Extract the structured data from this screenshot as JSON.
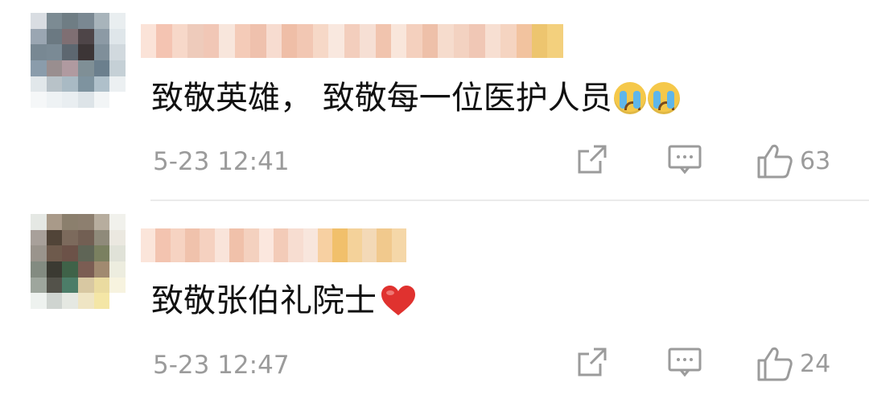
{
  "comments": [
    {
      "text": "致敬英雄， 致敬每一位医护人员",
      "emojis": [
        "crying-emoji",
        "crying-emoji"
      ],
      "time": "5-23 12:41",
      "like_count": "63",
      "avatar_colors": [
        "#d9dde2",
        "#7c8b93",
        "#6f7d84",
        "#7a8892",
        "#a8b4bb",
        "#e9eef0",
        "#9aa6b2",
        "#6b7982",
        "#7f6f73",
        "#4e4548",
        "#8c9aa5",
        "#dfe6ea",
        "#788893",
        "#7a8a95",
        "#5d6770",
        "#3c3536",
        "#7f8f9a",
        "#d1d9de",
        "#8a9cab",
        "#998e8f",
        "#b09aa0",
        "#7f8f96",
        "#6b7f8d",
        "#c5d0d6",
        "#e1e7ea",
        "#b8c2c8",
        "#a9bac4",
        "#7e939f",
        "#afc0ca",
        "#ecf0f2",
        "#f5f7f8",
        "#eef2f4",
        "#e9eef1",
        "#dde4e8",
        "#f2f5f6",
        "#ffffff"
      ],
      "username_colors": [
        "#fbe3d8",
        "#f4c4b2",
        "#f7d8c9",
        "#eecbbb",
        "#f1c7b6",
        "#f8e6dc",
        "#f4cbb8",
        "#efc1ad",
        "#f7dcd0",
        "#efbea7",
        "#f2c7b3",
        "#f6d8c7",
        "#f9e8df",
        "#f3cebd",
        "#f6dfd4",
        "#f1c4ae",
        "#f9e6db",
        "#f4d0be",
        "#eec0a9",
        "#f6dccd",
        "#f3d2c1",
        "#f0c7b5",
        "#f7dfd2",
        "#f5d4c1",
        "#f2c39f",
        "#edc56f",
        "#f3d07d"
      ]
    },
    {
      "text": "致敬张伯礼院士",
      "emojis": [
        "heart-emoji"
      ],
      "time": "5-23 12:47",
      "like_count": "24",
      "avatar_colors": [
        "#e5e8e4",
        "#a99a89",
        "#8b7f6d",
        "#8d7f6f",
        "#b7ad9e",
        "#f1f1ec",
        "#a8a09a",
        "#514438",
        "#7c6a5c",
        "#725f53",
        "#8f8a7a",
        "#ebe8e0",
        "#9a948c",
        "#6e5a4c",
        "#6c5248",
        "#5f6556",
        "#7a8060",
        "#e0e2d8",
        "#838b81",
        "#3b3a32",
        "#3f6248",
        "#7b5d53",
        "#a18a70",
        "#ededdf",
        "#9ea69d",
        "#53524a",
        "#4c7d68",
        "#d8c8a2",
        "#eadba0",
        "#f7f3df",
        "#eef2ef",
        "#cfd4d0",
        "#e5e8e2",
        "#efe5c4",
        "#f4e6a6",
        "#ffffff"
      ],
      "username_colors": [
        "#fbe5da",
        "#f3c4b0",
        "#f6d3c2",
        "#f0c2ac",
        "#f5d1c0",
        "#f9e4da",
        "#f0c1aa",
        "#f4d1bf",
        "#fbe7de",
        "#f3cbb8",
        "#f7ddd1",
        "#f8e6dd",
        "#f7d0a2",
        "#f1c06b",
        "#f4d29a",
        "#f3d9b7",
        "#f1c98d",
        "#f5d7a8"
      ]
    }
  ]
}
